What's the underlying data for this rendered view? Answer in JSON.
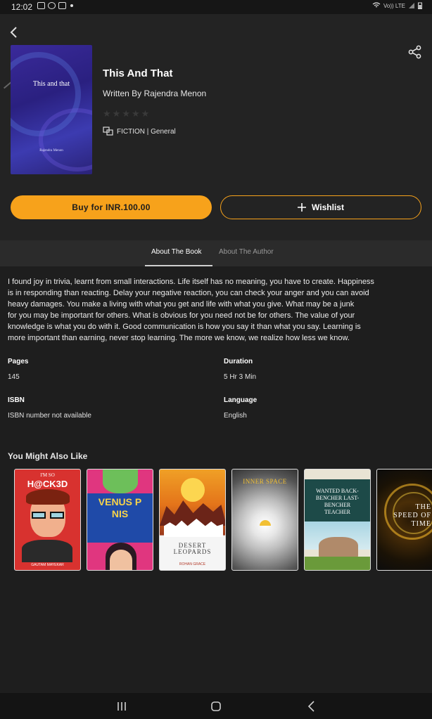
{
  "status_bar": {
    "time": "12:02",
    "network": "Vo)) LTE"
  },
  "book": {
    "title": "This And That",
    "author_line": "Written By Rajendra Menon",
    "rating_stars": 5,
    "rating_filled": 0,
    "genre": "FICTION | General",
    "cover_title": "This and that",
    "cover_author": "Rajendra Menon"
  },
  "actions": {
    "buy_label": "Buy for INR.100.00",
    "wishlist_label": "Wishlist"
  },
  "tabs": [
    {
      "label": "About The Book",
      "active": true
    },
    {
      "label": "About The Author",
      "active": false
    }
  ],
  "description_lines": [
    "I found joy in trivia, learnt from small interactions. Life itself has no meaning, you have to create. Happiness",
    "is in responding than reacting. Delay your negative reaction, you can check your anger and you can avoid",
    "heavy damages. You make a living with what you get and life with what you give. What may be a junk",
    "for you may be important for others. What is obvious for you need not be for others.  The value of your",
    "knowledge is what you do with it. Good communication is how you say it than what you say. Learning is",
    "more important than earning, never stop learning. The more we know, we realize how less we know."
  ],
  "details": {
    "pages_label": "Pages",
    "pages_value": "145",
    "duration_label": "Duration",
    "duration_value": "5 Hr 3 Min",
    "isbn_label": "ISBN",
    "isbn_value": "ISBN number not available",
    "language_label": "Language",
    "language_value": "English"
  },
  "recommendations": {
    "title": "You Might Also Like",
    "books": [
      {
        "title_top": "I'M SO",
        "title_main": "H@CK3D",
        "author": "GAUTAM MAYEKAR"
      },
      {
        "title_top": "",
        "title_main": "VENUS P NIS",
        "author": ""
      },
      {
        "title_top": "",
        "title_main": "DESERT LEOPARDS",
        "author": "ROHAN GRACE"
      },
      {
        "title_top": "",
        "title_main": "INNER SPACE",
        "author": ""
      },
      {
        "title_top": "",
        "title_main": "WANTED BACK-BENCHER LAST-BENCHER TEACHER",
        "author": ""
      },
      {
        "title_top": "",
        "title_main": "THE SPEED OF TIME",
        "author": ""
      }
    ]
  },
  "colors": {
    "accent": "#f7a21b",
    "background": "#1e1e1e",
    "header": "#232323",
    "tabs": "#2b2b2b"
  },
  "icons": {
    "back": "back-arrow-icon",
    "share": "share-icon",
    "genre": "genre-icon",
    "wishlist": "plus-icon",
    "nav_recents": "recents-icon",
    "nav_home": "home-icon",
    "nav_back": "nav-back-icon"
  }
}
